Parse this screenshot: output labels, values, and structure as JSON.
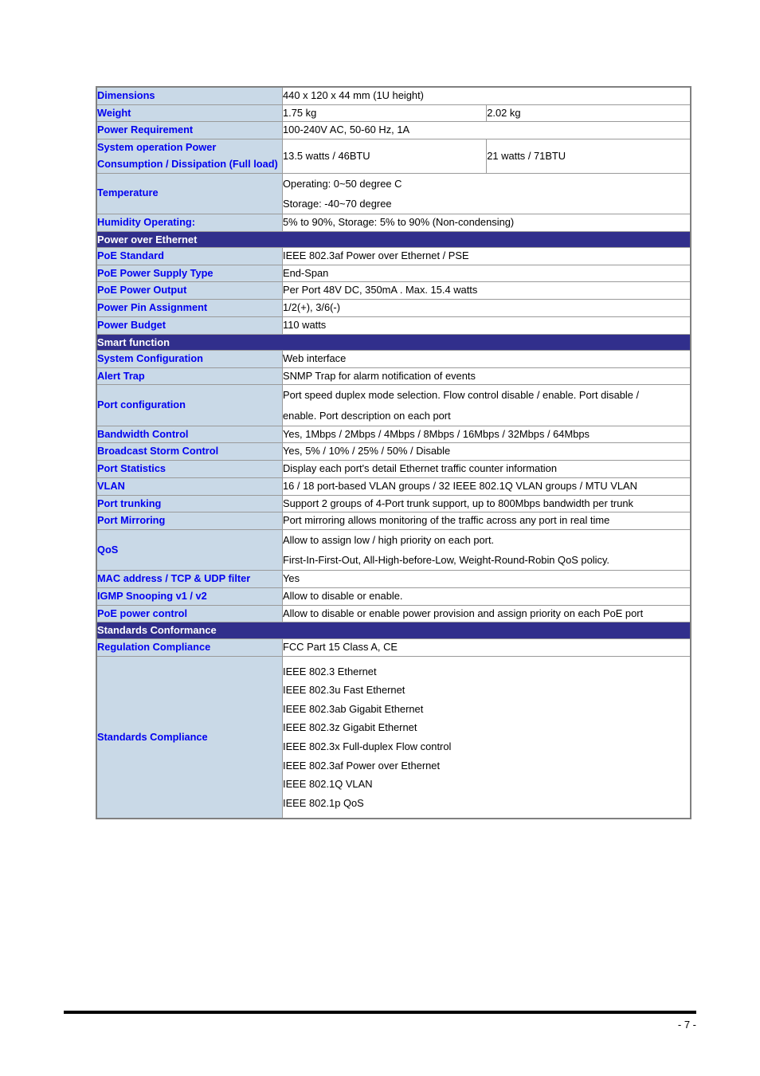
{
  "document": {
    "page_number": "- 7 -"
  },
  "spec_table": {
    "rows": [
      {
        "kind": "spec",
        "label": "Dimensions",
        "value": "440 x 120 x 44 mm (1U height)",
        "split": false
      },
      {
        "kind": "spec",
        "label": "Weight",
        "value": "1.75 kg",
        "value2": "2.02 kg",
        "split": true
      },
      {
        "kind": "spec",
        "label": "Power Requirement",
        "value": "100-240V AC, 50-60 Hz, 1A",
        "split": false
      },
      {
        "kind": "spec",
        "label": "System operation Power Consumption / Dissipation (Full load)",
        "value": "13.5 watts / 46BTU",
        "value2": "21 watts / 71BTU",
        "split": true
      },
      {
        "kind": "spec",
        "label": "Temperature",
        "lines": [
          "Operating: 0~50 degree C",
          "Storage: -40~70 degree"
        ],
        "split": false
      },
      {
        "kind": "spec",
        "label": "Humidity Operating:",
        "value": "5% to 90%, Storage: 5% to 90% (Non-condensing)",
        "split": false
      },
      {
        "kind": "section",
        "label": "Power over Ethernet"
      },
      {
        "kind": "spec",
        "label": "PoE Standard",
        "value": "IEEE 802.3af Power over Ethernet / PSE",
        "split": false
      },
      {
        "kind": "spec",
        "label": "PoE Power Supply Type",
        "value": "End-Span",
        "split": false
      },
      {
        "kind": "spec",
        "label": "PoE Power Output",
        "value": "Per Port 48V DC, 350mA . Max. 15.4 watts",
        "split": false
      },
      {
        "kind": "spec",
        "label": "Power Pin Assignment",
        "value": "1/2(+), 3/6(-)",
        "split": false
      },
      {
        "kind": "spec",
        "label": "Power Budget",
        "value": "110 watts",
        "split": false
      },
      {
        "kind": "section",
        "label": "Smart function"
      },
      {
        "kind": "spec",
        "label": "System Configuration",
        "value": "Web interface",
        "split": false
      },
      {
        "kind": "spec",
        "label": "Alert Trap",
        "value": "SNMP Trap for alarm notification of events",
        "split": false
      },
      {
        "kind": "spec",
        "label": "Port configuration",
        "lines": [
          "Port speed duplex mode selection. Flow control disable / enable. Port disable /",
          "enable. Port description on each port"
        ],
        "split": false
      },
      {
        "kind": "spec",
        "label": "Bandwidth Control",
        "value": "Yes, 1Mbps / 2Mbps / 4Mbps / 8Mbps / 16Mbps / 32Mbps / 64Mbps",
        "split": false
      },
      {
        "kind": "spec",
        "label": "Broadcast Storm Control",
        "value": "Yes, 5% / 10% / 25% / 50% / Disable",
        "split": false
      },
      {
        "kind": "spec",
        "label": "Port Statistics",
        "value": "Display each port's detail Ethernet traffic counter information",
        "split": false
      },
      {
        "kind": "spec",
        "label": "VLAN",
        "value": "16 / 18 port-based VLAN groups / 32 IEEE 802.1Q VLAN groups / MTU VLAN",
        "split": false
      },
      {
        "kind": "spec",
        "label": "Port trunking",
        "value": "Support 2 groups of 4-Port trunk support, up to 800Mbps bandwidth per trunk",
        "split": false
      },
      {
        "kind": "spec",
        "label": "Port Mirroring",
        "value": "Port mirroring allows monitoring of the traffic across any port in real time",
        "split": false
      },
      {
        "kind": "spec",
        "label": "QoS",
        "lines": [
          "Allow to assign low / high priority on each port.",
          "First-In-First-Out, All-High-before-Low, Weight-Round-Robin QoS policy."
        ],
        "split": false
      },
      {
        "kind": "spec",
        "label": "MAC address / TCP & UDP filter",
        "value": "Yes",
        "split": false
      },
      {
        "kind": "spec",
        "label": "IGMP Snooping v1 / v2",
        "value": "Allow to disable or enable.",
        "split": false
      },
      {
        "kind": "spec",
        "label": "PoE power control",
        "value": "Allow to disable or enable power provision and assign priority on each PoE port",
        "split": false
      },
      {
        "kind": "section",
        "label": "Standards Conformance"
      },
      {
        "kind": "spec",
        "label": "Regulation Compliance",
        "value": "FCC Part 15 Class A, CE",
        "split": false
      },
      {
        "kind": "spec",
        "label": "Standards Compliance",
        "lines": [
          "IEEE 802.3 Ethernet",
          "IEEE 802.3u Fast Ethernet",
          "IEEE 802.3ab Gigabit Ethernet",
          "IEEE 802.3z Gigabit Ethernet",
          "IEEE 802.3x Full-duplex Flow control",
          "IEEE 802.3af Power over Ethernet",
          "IEEE 802.1Q VLAN",
          "IEEE 802.1p QoS"
        ],
        "split": false
      }
    ]
  },
  "colors": {
    "section_band": "#312f8c",
    "label_bg": "#c9d9e7",
    "label_text": "#0000f0",
    "outer_border": "#808080",
    "inner_border": "#9a9a9a"
  }
}
